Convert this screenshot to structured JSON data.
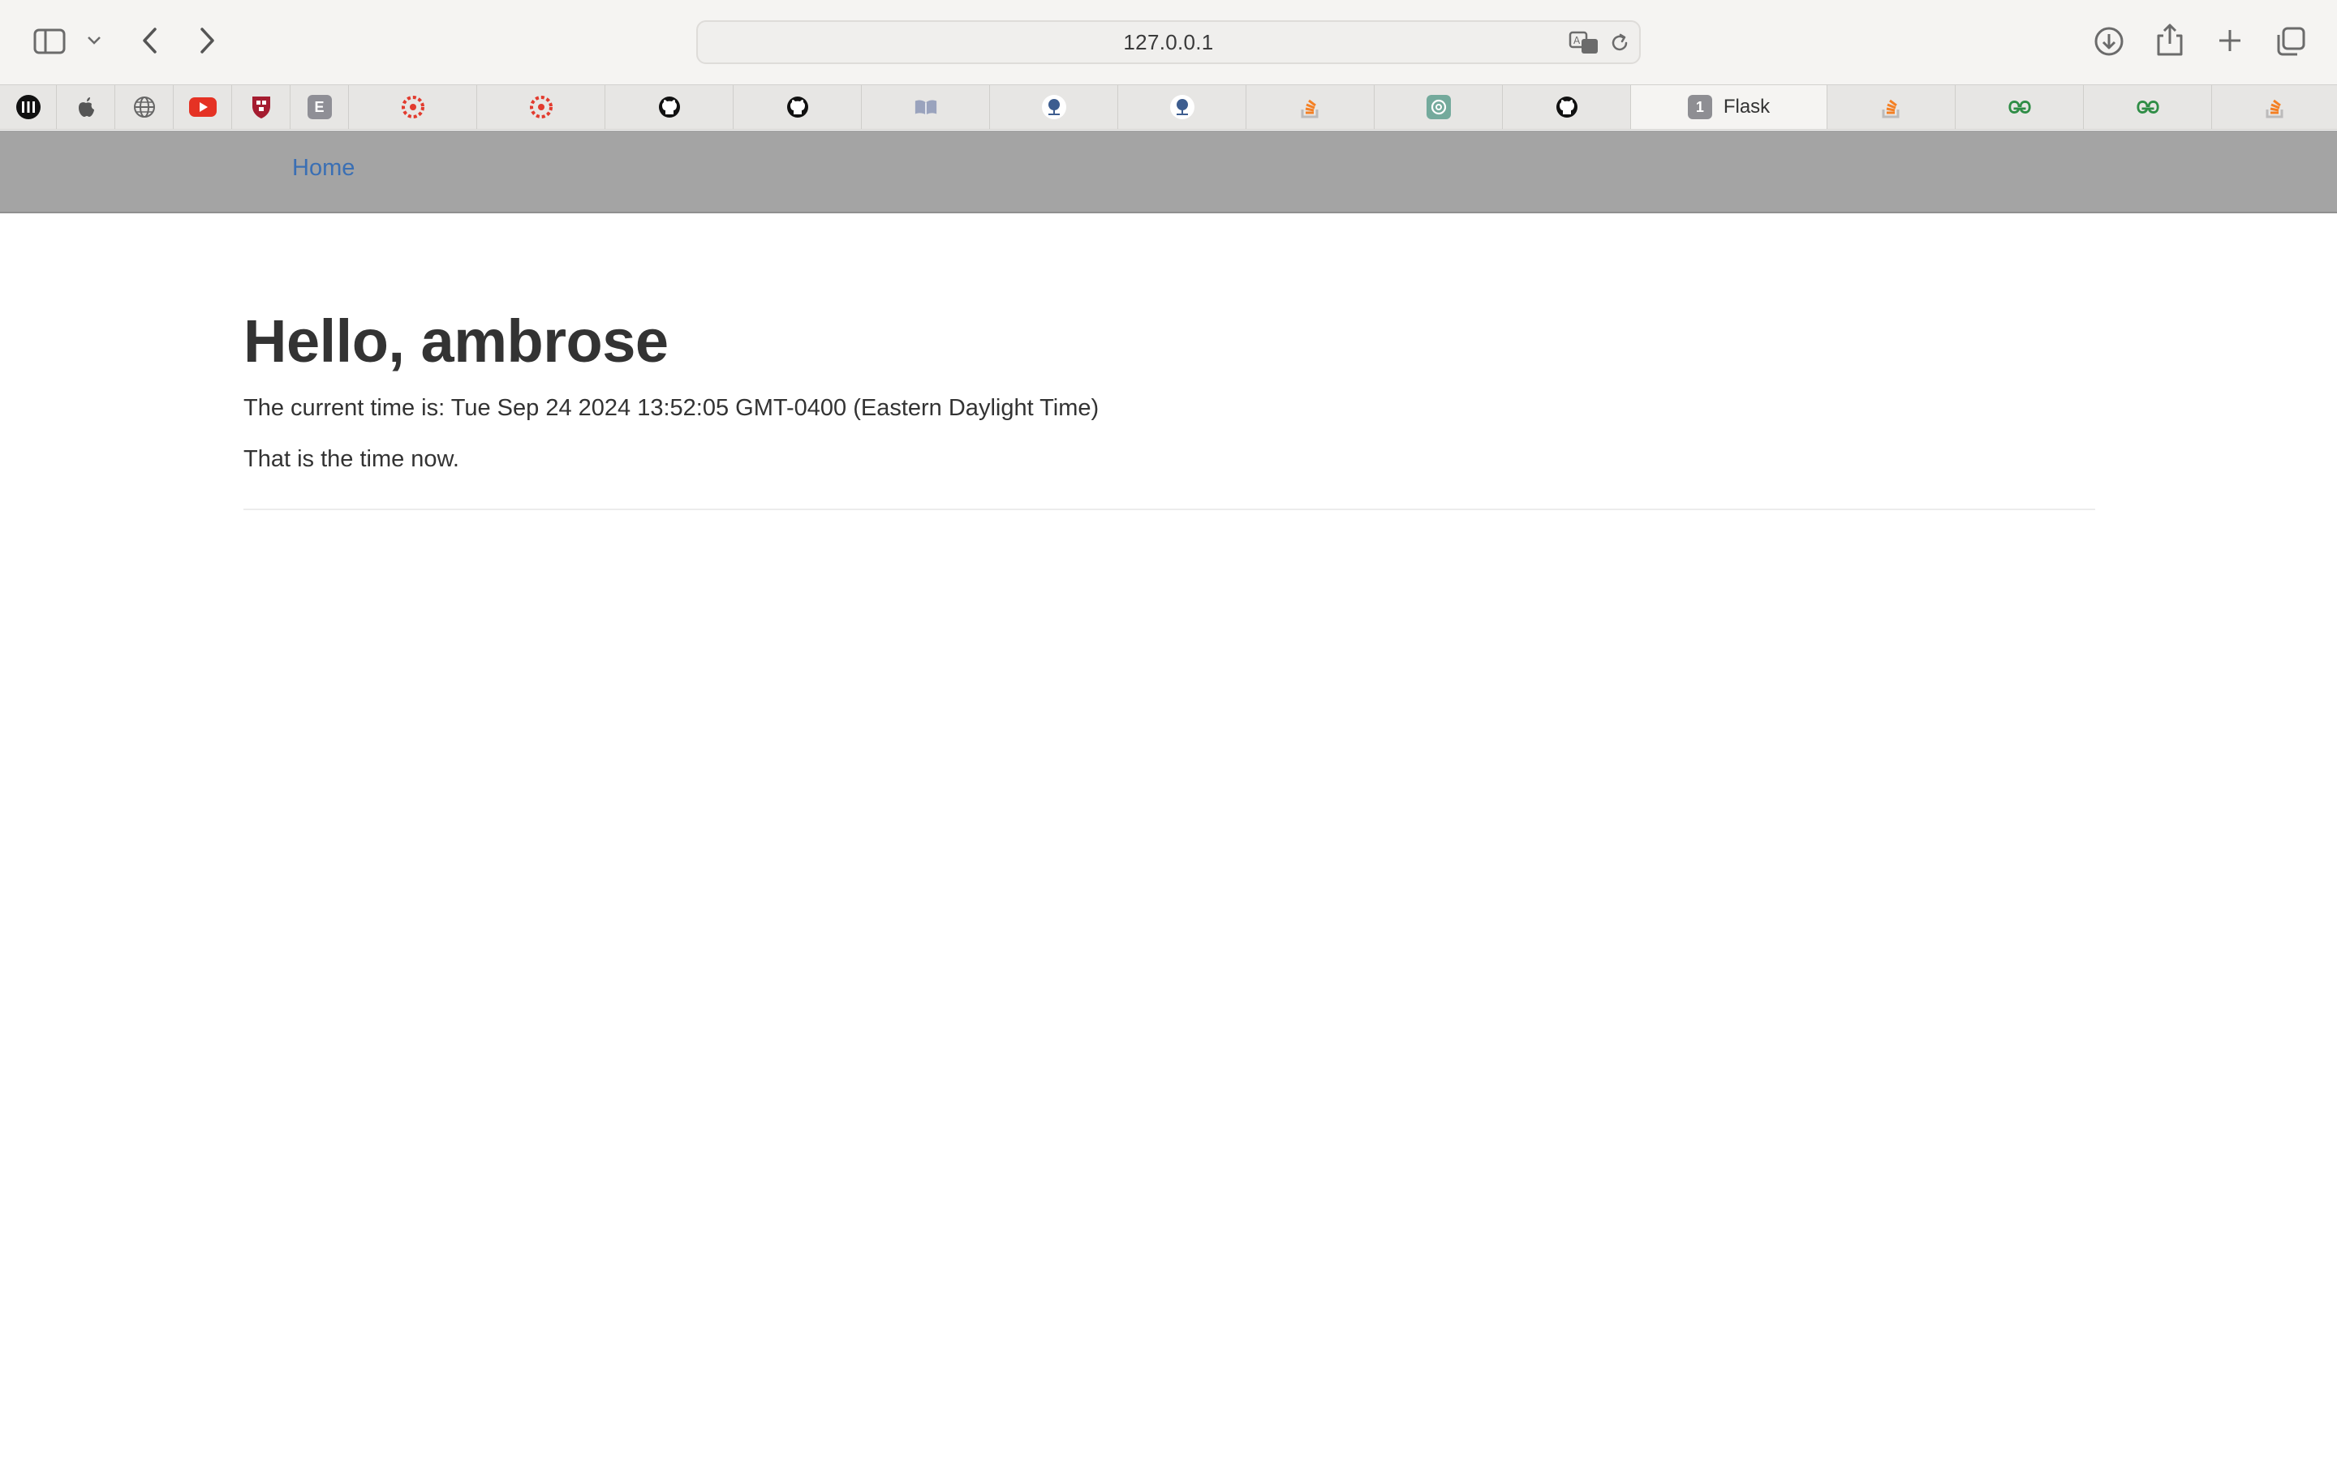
{
  "browser": {
    "url": "127.0.0.1",
    "active_tab_badge": "1",
    "active_tab_label": "Flask",
    "tabs": [
      {
        "icon": "pause-icon",
        "color": "#111111"
      },
      {
        "icon": "apple-icon",
        "color": "#555555"
      },
      {
        "icon": "globe-icon",
        "color": "#666666"
      },
      {
        "icon": "youtube-icon",
        "color": "#e53224"
      },
      {
        "icon": "harvard-shield-icon",
        "color": "#a51c30"
      },
      {
        "icon": "e-letter-icon",
        "color": "#8f8f96",
        "glyph": "E"
      },
      {
        "icon": "canvas-icon",
        "color": "#e23b2e"
      },
      {
        "icon": "canvas-icon",
        "color": "#e23b2e"
      },
      {
        "icon": "github-icon",
        "color": "#111111"
      },
      {
        "icon": "github-icon",
        "color": "#111111"
      },
      {
        "icon": "book-icon",
        "color": "#7a86a8"
      },
      {
        "icon": "tree-seal-icon",
        "color": "#3d5d8f"
      },
      {
        "icon": "tree-seal-icon",
        "color": "#3d5d8f"
      },
      {
        "icon": "stackoverflow-icon",
        "color": "#f48024"
      },
      {
        "icon": "chatgpt-icon",
        "color": "#74aa9c"
      },
      {
        "icon": "github-icon",
        "color": "#111111"
      },
      {
        "icon": "flask-active-tab",
        "color": "#8e8e93"
      },
      {
        "icon": "stackoverflow-icon",
        "color": "#f48024"
      },
      {
        "icon": "geeksforgeeks-icon",
        "color": "#2f8d46"
      },
      {
        "icon": "geeksforgeeks-icon",
        "color": "#2f8d46"
      },
      {
        "icon": "stackoverflow-icon",
        "color": "#f48024"
      }
    ]
  },
  "nav": {
    "home_label": "Home",
    "link_color": "#3a6fb4",
    "bar_color": "#a4a4a4"
  },
  "page": {
    "title": "Hello, ambrose",
    "time_line": "The current time is: Tue Sep 24 2024 13:52:05 GMT-0400 (Eastern Daylight Time)",
    "note": "That is the time now."
  }
}
